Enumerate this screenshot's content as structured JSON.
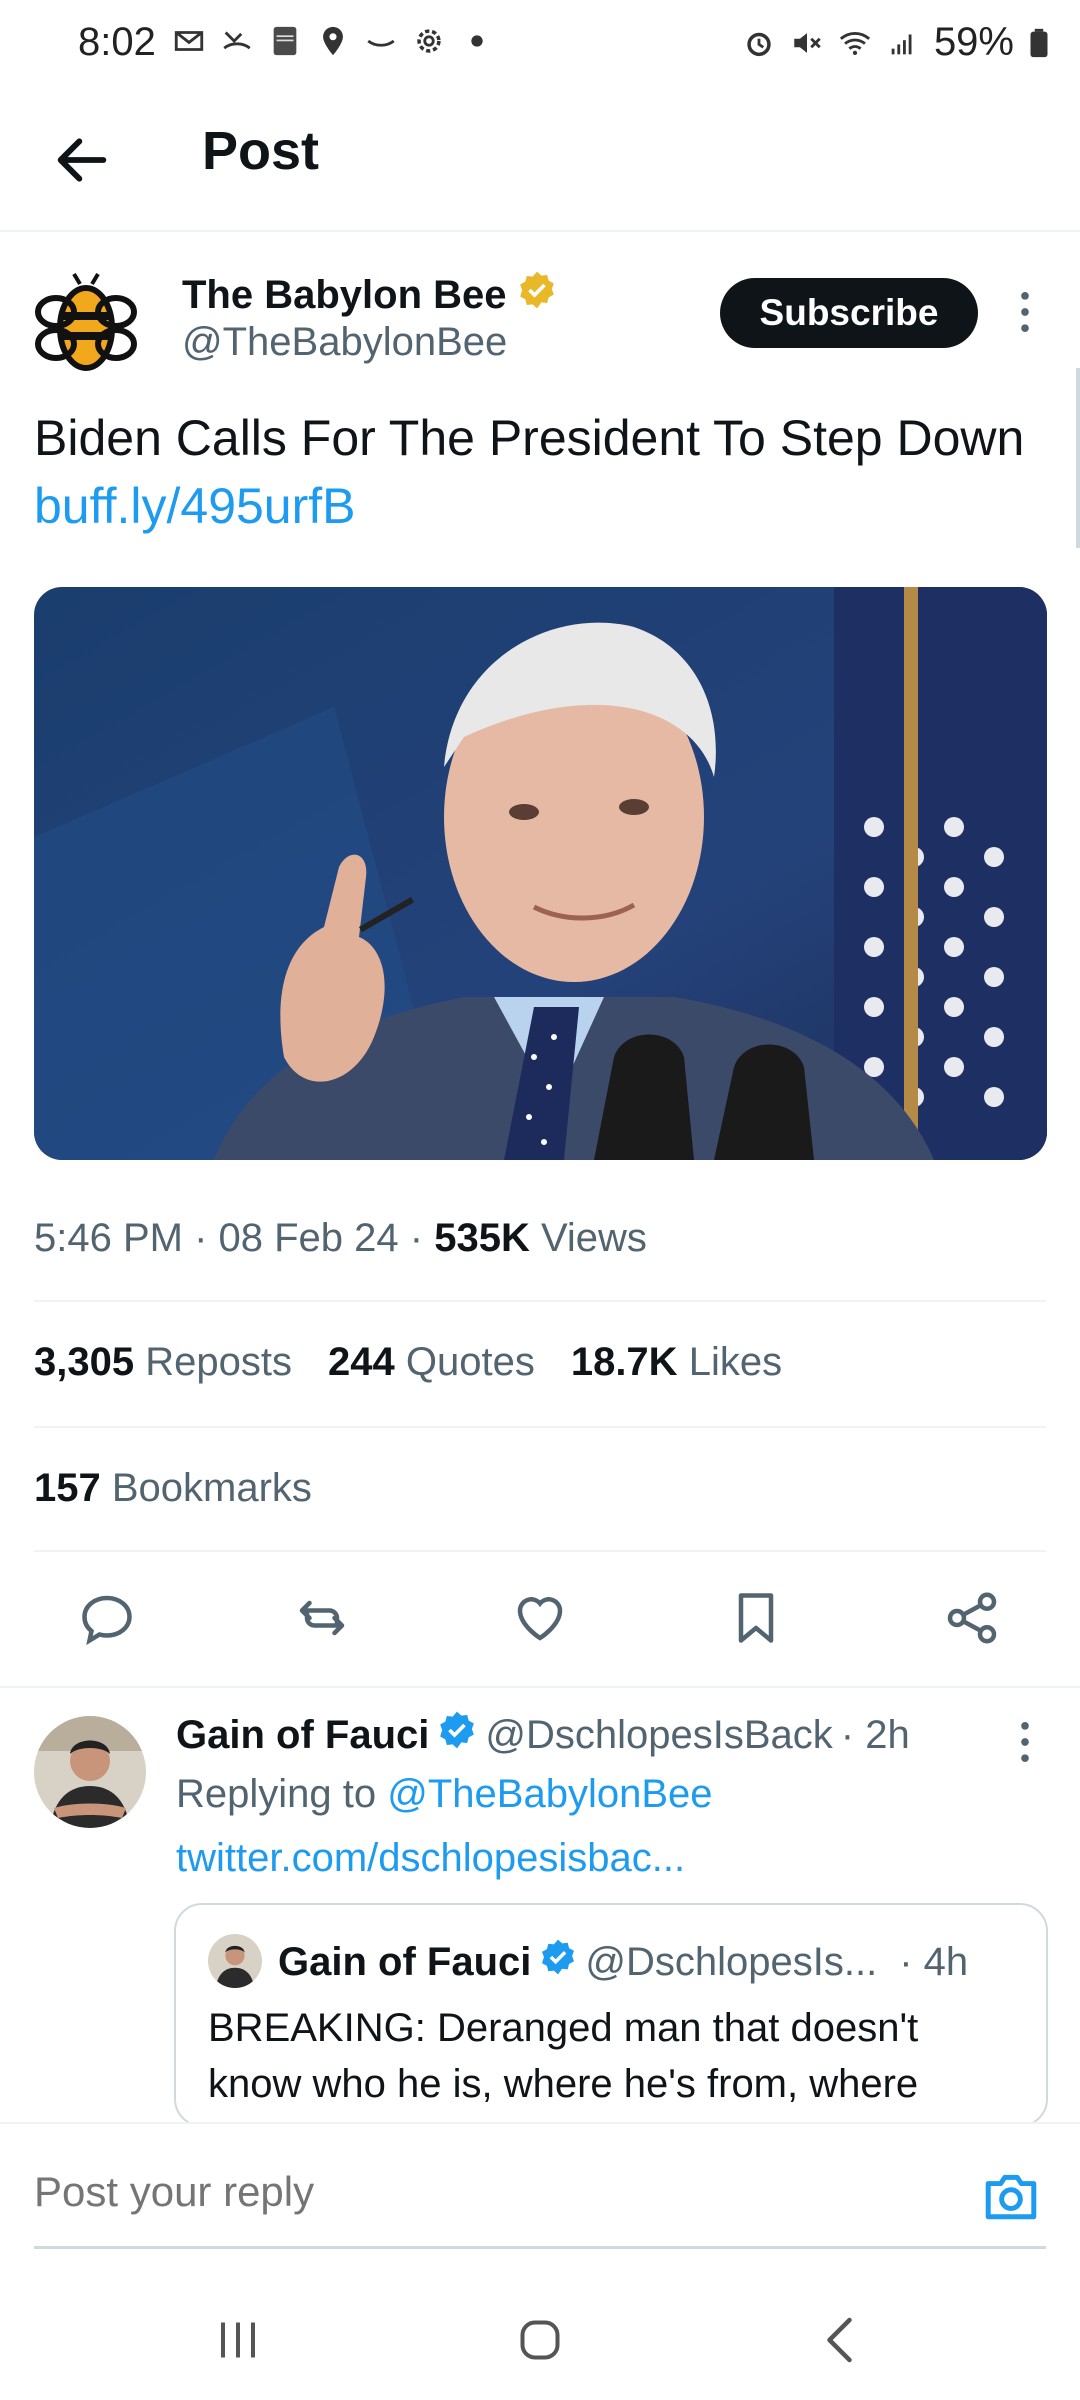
{
  "status_bar": {
    "time": "8:02",
    "battery": "59%",
    "icons_left": [
      "gmail-icon",
      "missed-call-icon",
      "holy-bible-icon",
      "location-icon",
      "amazon-icon",
      "settings-icon",
      "dot-icon"
    ],
    "icons_right": [
      "alarm-icon",
      "mute-icon",
      "wifi-icon",
      "signal-icon",
      "battery-icon"
    ]
  },
  "header": {
    "title": "Post"
  },
  "post": {
    "author_name": "The Babylon Bee",
    "author_handle": "@TheBabylonBee",
    "subscribe_label": "Subscribe",
    "text": "Biden Calls For The President To Step Down ",
    "link": "buff.ly/495urfB",
    "time": "5:46 PM",
    "date": "08 Feb 24",
    "views_count": "535K",
    "views_label": "Views",
    "reposts_count": "3,305",
    "reposts_label": "Reposts",
    "quotes_count": "244",
    "quotes_label": "Quotes",
    "likes_count": "18.7K",
    "likes_label": "Likes",
    "bookmarks_count": "157",
    "bookmarks_label": "Bookmarks"
  },
  "reply": {
    "name": "Gain of Fauci",
    "handle": "@DschlopesIsBack",
    "age": "· 2h",
    "replying_prefix": "Replying to ",
    "replying_to": "@TheBabylonBee",
    "link": "twitter.com/dschlopesisbac...",
    "quote": {
      "name": "Gain of Fauci",
      "handle": "@DschlopesIs...",
      "age": "· 4h",
      "text": "BREAKING: Deranged man that doesn't know who he is, where he's from, where"
    }
  },
  "composer": {
    "placeholder": "Post your reply"
  },
  "colors": {
    "accent": "#1d9bf0",
    "text": "#0f1419",
    "muted": "#536471",
    "verified_gold": "#e8b829"
  }
}
